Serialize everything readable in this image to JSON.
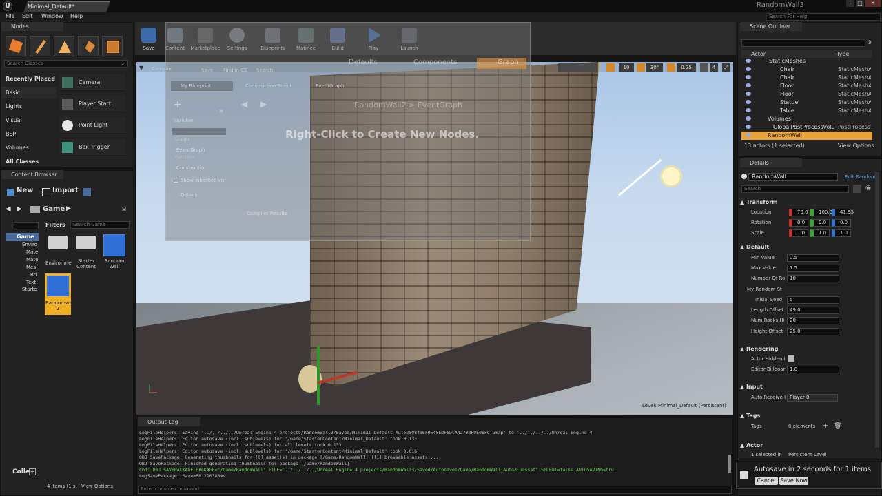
{
  "window": {
    "doc_tab": "Minimal_Default*",
    "app_name": "RandomWall3"
  },
  "menu": [
    "File",
    "Edit",
    "Window",
    "Help"
  ],
  "help_search_placeholder": "Search For Help",
  "modes": {
    "tab_label": "Modes",
    "search_placeholder": "Search Classes",
    "categories": [
      "Recently Placed",
      "Basic",
      "Lights",
      "Visual",
      "BSP",
      "Volumes",
      "All Classes"
    ],
    "items": [
      "Camera",
      "Player Start",
      "Point Light",
      "Box Trigger"
    ]
  },
  "toolbar": [
    {
      "label": "Save"
    },
    {
      "label": "Content"
    },
    {
      "label": "Marketplace"
    },
    {
      "label": "Settings"
    },
    {
      "label": "Blueprints"
    },
    {
      "label": "Matinee"
    },
    {
      "label": "Build"
    },
    {
      "label": "Play"
    },
    {
      "label": "Launch"
    }
  ],
  "content_browser": {
    "tab_label": "Content Browser",
    "new_label": "New",
    "import_label": "Import",
    "path": "Game",
    "filters_label": "Filters",
    "search_placeholder": "Search Game",
    "tree": [
      "Game",
      "Enviro",
      "Mate",
      "Mate",
      "Mes",
      "Bri",
      "Text",
      "Starte"
    ],
    "assets": [
      {
        "name": "Environme"
      },
      {
        "name": "Starter Content"
      },
      {
        "name": "Random Wall"
      },
      {
        "name": "Randomwall 2"
      }
    ],
    "collections_label": "Colle",
    "count_label": "4 items (1 s",
    "view_options": "View Options"
  },
  "blueprint_overlay": {
    "tabs": [
      "My Blueprint",
      "Construction Script",
      "EventGraph"
    ],
    "breadcrumb": "RandomWall2 > EventGraph",
    "hint": "Right-Click to Create New Nodes.",
    "variable_label": "Variable",
    "graphs_label": "Graphs",
    "eventgraph": "EventGraph",
    "functions_label": "Functions",
    "construction": "Constructio",
    "show_inherited": "Show inherited var",
    "details_label": "Details",
    "compiler_results": "Compiler Results",
    "mode_tabs": [
      "Defaults",
      "Components",
      "Graph"
    ],
    "toolbar": [
      "Compile",
      "Save",
      "Find in CB",
      "Search"
    ]
  },
  "viewport": {
    "snap_value": "10",
    "rot_value": "30°",
    "scale_value": "0.25",
    "cam_speed": "4",
    "level_label": "Level: Minimal_Default (Persistent)"
  },
  "output_log": {
    "tab_label": "Output Log",
    "lines": [
      "LogFileHelpers: Saving '../../../../Unreal Engine 4 projects/RandomWall3/Saved/Minimal_Default_Auto2008406F9540EDF6DCA4270BF9E06FC.umap' to '../../../../Unreal Engine 4",
      "LogFileHelpers: Editor autosave (incl. sublevels) for '/Game/StarterContent/Minimal_Default' took 0.133",
      "LogFileHelpers: Editor autosave (incl. sublevels) for all levels took 0.133",
      "LogFileHelpers: Editor autosave (incl. sublevels) for '/Game/StarterContent/Minimal_Default' took 0.016",
      "OBJ SavePackage: Generating thumbnails for [0] asset(s) in package [/Game/RandomWall] ([1] browsable assets)...",
      "OBJ SavePackage: Finished generating thumbnails for package [/Game/RandomWall]",
      "Cmd: OBJ SAVEPACKAGE PACKAGE=\"/Game/RandomWall\" FILE=\"../../../../Unreal Engine 4 projects/RandomWall3/Saved/Autosaves/Game/RandomWall_Auto3.uasset\" SILENT=false AUTOSAVING=tru",
      "LogSavePackage: Save=68.210388ms"
    ],
    "console_placeholder": "Enter console command"
  },
  "outliner": {
    "tab_label": "Scene Outliner",
    "col_actor": "Actor",
    "col_type": "Type",
    "rows": [
      {
        "name": "StaticMeshes",
        "type": ""
      },
      {
        "name": "Chair",
        "type": "StaticMeshAc"
      },
      {
        "name": "Chair",
        "type": "StaticMeshAc"
      },
      {
        "name": "Floor",
        "type": "StaticMeshAc"
      },
      {
        "name": "Floor",
        "type": "StaticMeshAc"
      },
      {
        "name": "Statue",
        "type": "StaticMeshAc"
      },
      {
        "name": "Table",
        "type": "StaticMeshAc"
      },
      {
        "name": "Volumes",
        "type": ""
      },
      {
        "name": "GlobalPostProcessVolum",
        "type": "PostProcessV"
      },
      {
        "name": "RandomWall",
        "type": ""
      }
    ],
    "status": "13 actors (1 selected)",
    "view_options": "View Options"
  },
  "details": {
    "tab_label": "Details",
    "actor_name": "RandomWall",
    "edit_link": "Edit Random",
    "search_placeholder": "Search",
    "transform": {
      "title": "Transform",
      "location_label": "Location",
      "location": [
        "70.0",
        "100.0",
        "41.95"
      ],
      "rotation_label": "Rotation",
      "rotation": [
        "0.0",
        "0.0",
        "0.0"
      ],
      "scale_label": "Scale",
      "scale": [
        "1.0",
        "1.0",
        "1.0"
      ]
    },
    "default": {
      "title": "Default",
      "rows": [
        {
          "label": "Min Value",
          "value": "0.5"
        },
        {
          "label": "Max Value",
          "value": "1.5"
        },
        {
          "label": "Number Of Ro",
          "value": "10"
        },
        {
          "label": "My Random St",
          "value": ""
        },
        {
          "label": "Initial Seed",
          "value": "5"
        },
        {
          "label": "Length Offset",
          "value": "49.0"
        },
        {
          "label": "Num Rocks Hi",
          "value": "20"
        },
        {
          "label": "Height Offset",
          "value": "25.0"
        }
      ]
    },
    "rendering": {
      "title": "Rendering",
      "hidden_label": "Actor Hidden i",
      "billboard_label": "Editor Billboar",
      "billboard_value": "1.0"
    },
    "input": {
      "title": "Input",
      "auto_receive_label": "Auto Receive I",
      "auto_receive_value": "Player 0"
    },
    "tags": {
      "title": "Tags",
      "label": "Tags",
      "value": "0 elements"
    },
    "actor": {
      "title": "Actor",
      "selected_label": "1 selected in",
      "selected_value": "Persistent Level"
    }
  },
  "notification": {
    "text": "Autosave in 2 seconds for 1 items",
    "cancel": "Cancel",
    "save_now": "Save Now"
  }
}
